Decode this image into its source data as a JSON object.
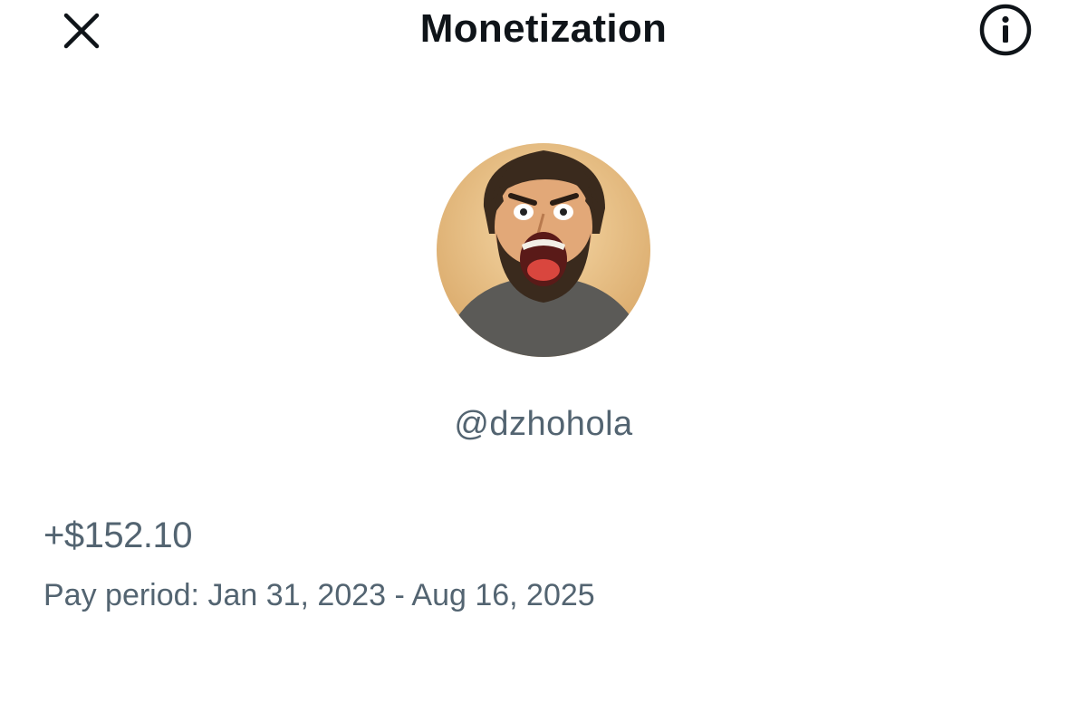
{
  "header": {
    "title": "Monetization",
    "close_icon": "close-icon",
    "info_icon": "info-icon"
  },
  "profile": {
    "avatar": "avatar-cartoon-shouting-man",
    "handle": "@dzhohola"
  },
  "earnings": {
    "amount": "+$152.10",
    "pay_period": "Pay period: Jan 31, 2023 - Aug 16, 2025"
  },
  "colors": {
    "text_primary": "#0f1419",
    "text_secondary": "#536471",
    "background": "#ffffff"
  }
}
